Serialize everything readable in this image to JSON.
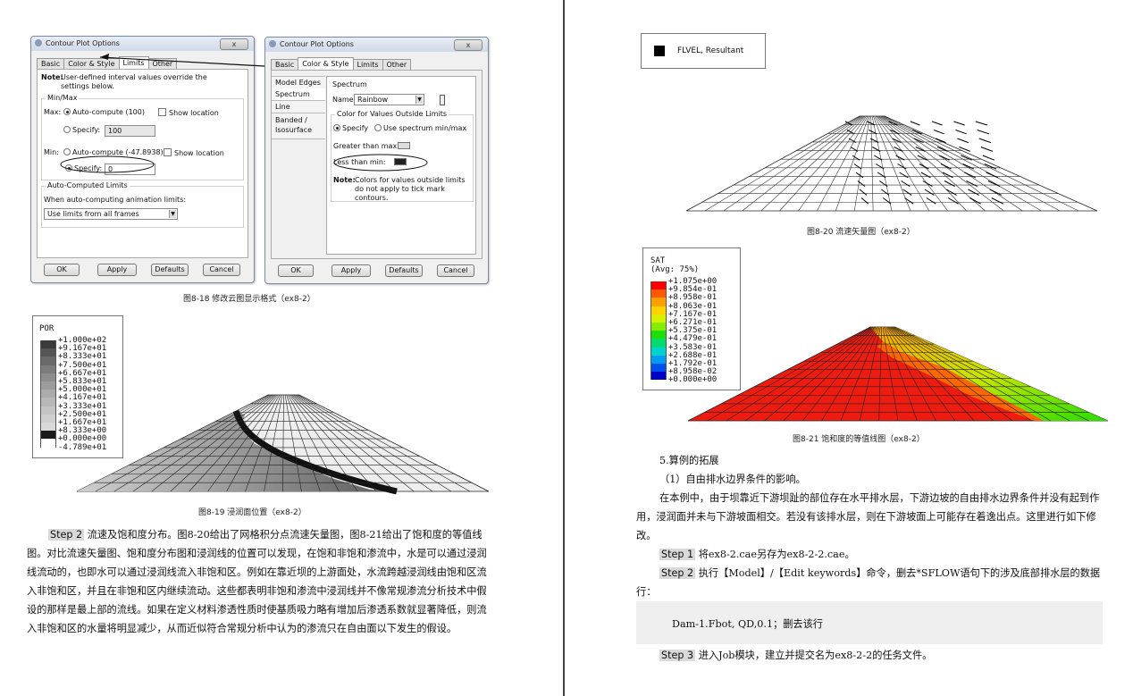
{
  "dialog1": {
    "title": "Contour Plot Options",
    "close": "x",
    "tabs": [
      "Basic",
      "Color & Style",
      "Limits",
      "Other"
    ],
    "note_label": "Note:",
    "note_text": "User-defined interval values override the settings below.",
    "minmax_label": "Min/Max",
    "max_label": "Max:",
    "max_auto": "Auto-compute (100)",
    "max_show": "Show location",
    "max_specify": "Specify:",
    "max_value": "100",
    "min_label": "Min:",
    "min_auto": "Auto-compute (-47.8938)",
    "min_show": "Show location",
    "min_specify": "Specify:",
    "min_value": "0",
    "auto_label": "Auto-Computed Limits",
    "auto_when": "When auto-computing animation limits:",
    "auto_select": "Use limits from all frames",
    "buttons": [
      "OK",
      "Apply",
      "Defaults",
      "Cancel"
    ]
  },
  "dialog2": {
    "title": "Contour Plot Options",
    "close": "x",
    "tabs": [
      "Basic",
      "Color & Style",
      "Limits",
      "Other"
    ],
    "side": [
      "Model Edges",
      "Spectrum",
      "Line",
      "Banded / Isosurface"
    ],
    "spectrum_label": "Spectrum",
    "name_label": "Name:",
    "name_value": "Rainbow",
    "outside_label": "Color for Values Outside Limits",
    "specify": "Specify",
    "use_spectrum": "Use spectrum min/max",
    "greater": "Greater than max:",
    "less": "Less than min:",
    "note_label": "Note:",
    "note_text": "Colors for values outside limits do not apply to tick mark contours.",
    "buttons": [
      "OK",
      "Apply",
      "Defaults",
      "Cancel"
    ]
  },
  "captions": {
    "fig18": "图8-18 修改云图显示格式（ex8-2）",
    "fig19": "图8-19 浸润面位置（ex8-2）",
    "fig20": "图8-20 流速矢量图（ex8-2）",
    "fig21": "图8-21 饱和度的等值线图（ex8-2）"
  },
  "por_legend": {
    "title": "POR",
    "values": [
      "+1.000e+02",
      "+9.167e+01",
      "+8.333e+01",
      "+7.500e+01",
      "+6.667e+01",
      "+5.833e+01",
      "+5.000e+01",
      "+4.167e+01",
      "+3.333e+01",
      "+2.500e+01",
      "+1.667e+01",
      "+8.333e+00",
      "+0.000e+00",
      "-4.789e+01"
    ],
    "colors": [
      "#3a3a3a",
      "#555555",
      "#6a6a6a",
      "#7c7c7c",
      "#8d8d8d",
      "#9c9c9c",
      "#ababab",
      "#b8b8b8",
      "#c4c4c4",
      "#cfcfcf",
      "#d9d9d9",
      "#1a1a1a",
      "#ffffff"
    ]
  },
  "flvel_legend": {
    "label": "FLVEL, Resultant"
  },
  "sat_legend": {
    "title": "SAT",
    "avg": "(Avg: 75%)",
    "values": [
      "+1.075e+00",
      "+9.854e-01",
      "+8.958e-01",
      "+8.063e-01",
      "+7.167e-01",
      "+6.271e-01",
      "+5.375e-01",
      "+4.479e-01",
      "+3.583e-01",
      "+2.688e-01",
      "+1.792e-01",
      "+8.958e-02",
      "+0.000e+00"
    ],
    "colors": [
      "#ff0000",
      "#ff5a00",
      "#ffa000",
      "#ffd200",
      "#d8f000",
      "#86ec00",
      "#1ee000",
      "#00dc6e",
      "#00d2d2",
      "#009cf0",
      "#0050f0",
      "#0000c8"
    ]
  },
  "left_text": {
    "step": "Step 2",
    "text": " 流速及饱和度分布。图8-20给出了网格积分点流速矢量图，图8-21给出了饱和度的等值线图。对比流速矢量图、饱和度分布图和浸润线的位置可以发现，在饱和非饱和渗流中，水是可以通过浸润线流动的，也即水可以通过浸润线流入非饱和区。例如在靠近坝的上游面处，水流跨越浸润线由饱和区流入非饱和区，并且在非饱和区内继续流动。这些都表明非饱和渗流中浸润线并不像常规渗流分析技术中假设的那样是最上部的流线。如果在定义材料渗透性质时使基质吸力略有增加后渗透系数就显著降低，则流入非饱和区的水量将明显减少，从而近似符合常规分析中认为的渗流只在自由面以下发生的假设。"
  },
  "right_text": {
    "section": "5.算例的拓展",
    "sub": "（1）自由排水边界条件的影响。",
    "p1": "在本例中，由于坝靠近下游坝趾的部位存在水平排水层，下游边坡的自由排水边界条件并没有起到作用，浸润面并未与下游坡面相交。若没有该排水层，则在下游坡面上可能存在着逸出点。这里进行如下修改。",
    "s1": "Step 1",
    "s1_text": " 将ex8-2.cae另存为ex8-2-2.cae。",
    "s2": "Step 2",
    "s2_text": " 执行【Model】/【Edit keywords】命令，删去*SFLOW语句下的涉及底部排水层的数据行：",
    "code": "Dam-1.Fbot, QD,0.1；删去该行",
    "s3": "Step 3",
    "s3_text": " 进入Job模块，建立并提交名为ex8-2-2的任务文件。"
  }
}
